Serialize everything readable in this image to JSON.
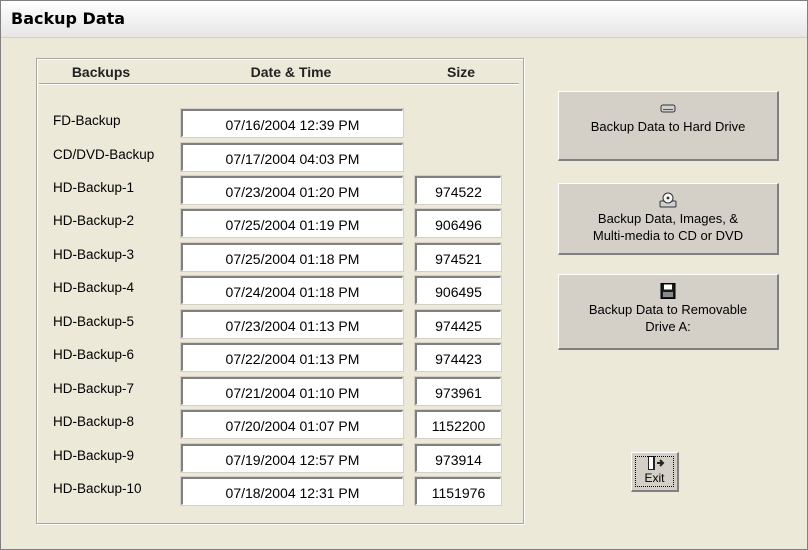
{
  "window": {
    "title": "Backup Data"
  },
  "headers": {
    "backups": "Backups",
    "datetime": "Date & Time",
    "size": "Size"
  },
  "rows": [
    {
      "label": "FD-Backup",
      "datetime": "07/16/2004 12:39 PM",
      "size": ""
    },
    {
      "label": "CD/DVD-Backup",
      "datetime": "07/17/2004 04:03 PM",
      "size": ""
    },
    {
      "label": "HD-Backup-1",
      "datetime": "07/23/2004 01:20 PM",
      "size": "974522"
    },
    {
      "label": "HD-Backup-2",
      "datetime": "07/25/2004 01:19 PM",
      "size": "906496"
    },
    {
      "label": "HD-Backup-3",
      "datetime": "07/25/2004 01:18 PM",
      "size": "974521"
    },
    {
      "label": "HD-Backup-4",
      "datetime": "07/24/2004 01:18 PM",
      "size": "906495"
    },
    {
      "label": "HD-Backup-5",
      "datetime": "07/23/2004 01:13 PM",
      "size": "974425"
    },
    {
      "label": "HD-Backup-6",
      "datetime": "07/22/2004 01:13 PM",
      "size": "974423"
    },
    {
      "label": "HD-Backup-7",
      "datetime": "07/21/2004 01:10 PM",
      "size": "973961"
    },
    {
      "label": "HD-Backup-8",
      "datetime": "07/20/2004 01:07 PM",
      "size": "1152200"
    },
    {
      "label": "HD-Backup-9",
      "datetime": "07/19/2004 12:57 PM",
      "size": "973914"
    },
    {
      "label": "HD-Backup-10",
      "datetime": "07/18/2004 12:31 PM",
      "size": "1151976"
    }
  ],
  "buttons": {
    "hard_drive": {
      "label": "Backup Data to Hard Drive",
      "icon": "hard-drive-icon"
    },
    "cd_dvd": {
      "line1": "Backup Data, Images, &",
      "line2": "Multi-media to CD or DVD",
      "icon": "cd-drive-icon"
    },
    "removable": {
      "line1": "Backup Data to Removable",
      "line2": "Drive A:",
      "icon": "floppy-disk-icon"
    },
    "exit": {
      "label": "Exit",
      "icon": "exit-door-icon"
    }
  }
}
